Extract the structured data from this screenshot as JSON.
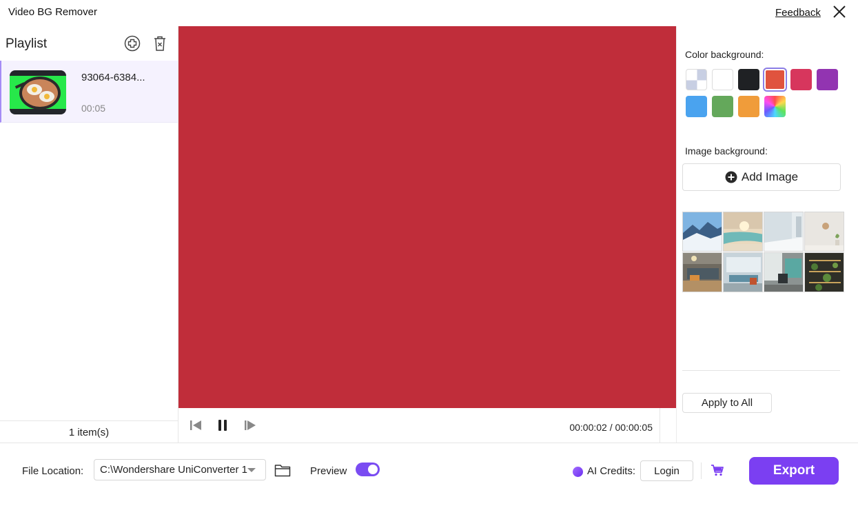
{
  "app": {
    "title": "Video BG Remover",
    "feedback_label": "Feedback"
  },
  "playlist": {
    "title": "Playlist",
    "items": [
      {
        "name": "93064-6384...",
        "duration": "00:05"
      }
    ],
    "count_label": "1 item(s)"
  },
  "player": {
    "background_color": "#c02d3a",
    "timecode": "00:00:02 / 00:00:05"
  },
  "right_panel": {
    "color_background_label": "Color background:",
    "swatches": [
      {
        "name": "transparent",
        "color": "checker"
      },
      {
        "name": "white",
        "color": "#ffffff"
      },
      {
        "name": "black",
        "color": "#1f2124"
      },
      {
        "name": "orange-red",
        "color": "#e0533e",
        "selected": true
      },
      {
        "name": "crimson",
        "color": "#d7365d"
      },
      {
        "name": "purple",
        "color": "#9234b1"
      },
      {
        "name": "blue",
        "color": "#4aa3ef"
      },
      {
        "name": "green",
        "color": "#64a85b"
      },
      {
        "name": "orange",
        "color": "#f09c3a"
      },
      {
        "name": "custom-gradient",
        "color": "gradient"
      }
    ],
    "image_background_label": "Image background:",
    "add_image_label": "Add Image",
    "image_backgrounds": [
      "snowy-mountains",
      "beach-sunset",
      "white-room",
      "wall-clock-room",
      "office-lobby",
      "meeting-room",
      "office-chair-room",
      "plant-shelves"
    ],
    "apply_all_label": "Apply to All"
  },
  "bottom": {
    "file_location_label": "File Location:",
    "file_location_value": "C:\\Wondershare UniConverter 1",
    "preview_label": "Preview",
    "preview_on": true,
    "ai_credits_label": "AI Credits:",
    "login_label": "Login",
    "export_label": "Export",
    "accent": "#7b3ff2"
  }
}
